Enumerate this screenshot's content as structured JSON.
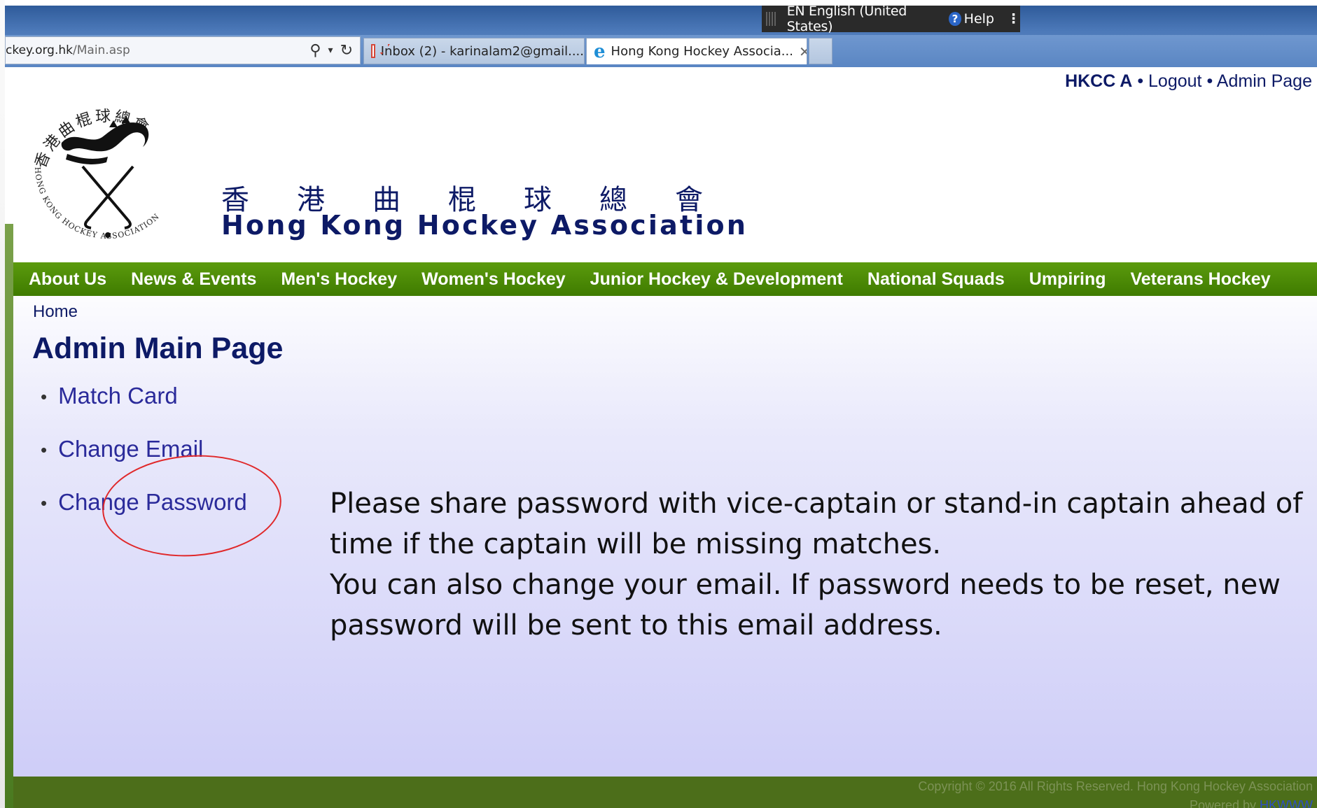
{
  "browser": {
    "language_bar": {
      "language": "EN English (United States)",
      "help": "Help"
    },
    "address_url_domain": "ckey.org.hk",
    "address_url_path": "/Main.asp",
    "tabs": [
      {
        "label": "Inbox (2) - karinalam2@gmail...."
      },
      {
        "label": "Hong Kong Hockey Associa..."
      }
    ]
  },
  "header": {
    "user": "HKCC A",
    "separator": "•",
    "logout": "Logout",
    "admin_page": "Admin Page",
    "org_name_cn": "香港曲棍球總會",
    "org_name_en": "Hong Kong Hockey Association",
    "logo_cn_text": "香港曲棍球總會",
    "logo_en_text": "HONG KONG HOCKEY ASSOCIATION"
  },
  "nav": {
    "items": [
      "About Us",
      "News & Events",
      "Men's Hockey",
      "Women's Hockey",
      "Junior Hockey & Development",
      "National Squads",
      "Umpiring",
      "Veterans Hockey"
    ]
  },
  "main": {
    "breadcrumb": "Home",
    "title": "Admin Main Page",
    "links": [
      "Match Card",
      "Change Email",
      "Change Password"
    ],
    "bullet": "•",
    "note_line1": "Please share password with vice-captain or stand-in captain ahead of time if the captain will be missing matches.",
    "note_line2": "You can also change your email. If password needs to be reset, new password will be sent to this email address."
  },
  "footer": {
    "copyright": "Copyright © 2016 All Rights Reserved. Hong Kong Hockey Association",
    "powered_by": "Powered by",
    "powered_link": "HKWWW"
  },
  "colors": {
    "nav_green": "#4f8c08",
    "brand_navy": "#0d1a66",
    "link_blue": "#2a2a9a",
    "annotation_red": "#e0282a"
  }
}
